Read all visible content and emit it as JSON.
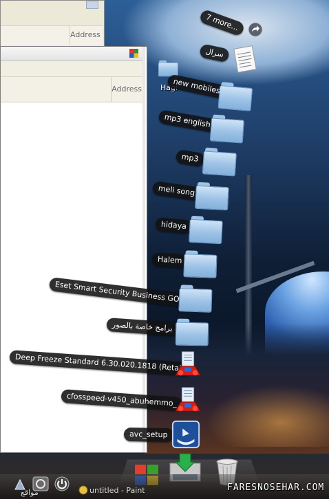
{
  "back_window": {
    "address_label": "Address"
  },
  "front_window": {
    "address_label": "Address"
  },
  "desktop": {
    "hagr_label": "Hagr"
  },
  "stack": {
    "more_label": "7 more...",
    "items": [
      {
        "label": "سرال",
        "icon": "document-icon"
      },
      {
        "label": "new mobiles",
        "icon": "folder-icon"
      },
      {
        "label": "mp3 english",
        "icon": "folder-icon"
      },
      {
        "label": "mp3",
        "icon": "folder-icon"
      },
      {
        "label": "meli song",
        "icon": "folder-icon"
      },
      {
        "label": "hidaya",
        "icon": "folder-icon"
      },
      {
        "label": "Halem",
        "icon": "folder-icon"
      },
      {
        "label": "Eset Smart Security Business GOLD",
        "icon": "folder-icon"
      },
      {
        "label": "برامج خاصة بالصور",
        "icon": "folder-icon"
      },
      {
        "label": "Deep Freeze Standard 6.30.020.1818 (Retail)",
        "icon": "installer-icon"
      },
      {
        "label": "cfosspeed-v450_abuhemmo_",
        "icon": "installer-icon"
      },
      {
        "label": "avc_setup",
        "icon": "avc-icon"
      }
    ]
  },
  "taskbar": {
    "left_text": "مواقع",
    "paint_label": "untitled - Paint",
    "watermark": "FARESNOSEHAR.COM"
  },
  "colors": {
    "label_bg": "#121212",
    "folder_blue": "#9cc2e6",
    "window_bg": "#ece9d8"
  }
}
